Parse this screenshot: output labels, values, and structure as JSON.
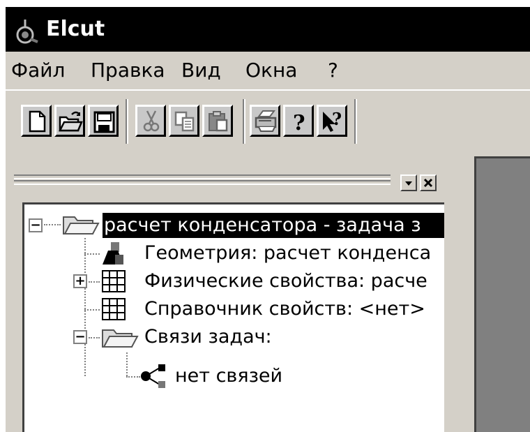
{
  "window": {
    "title": "Elcut"
  },
  "menu": [
    "Файл",
    "Правка",
    "Вид",
    "Окна",
    "?"
  ],
  "toolbar": [
    "new-icon",
    "open-icon",
    "save-icon",
    "cut-icon",
    "copy-icon",
    "paste-icon",
    "print-icon",
    "help-icon",
    "context-help-icon"
  ],
  "tree": {
    "root": "расчет конденсатора -  задача з",
    "geometry": "Геометрия: расчет конденса",
    "physical": "Физические свойства: расче",
    "library": "Справочник свойств: <нет>",
    "links": "Связи задач:",
    "no_links": "нет связей"
  }
}
